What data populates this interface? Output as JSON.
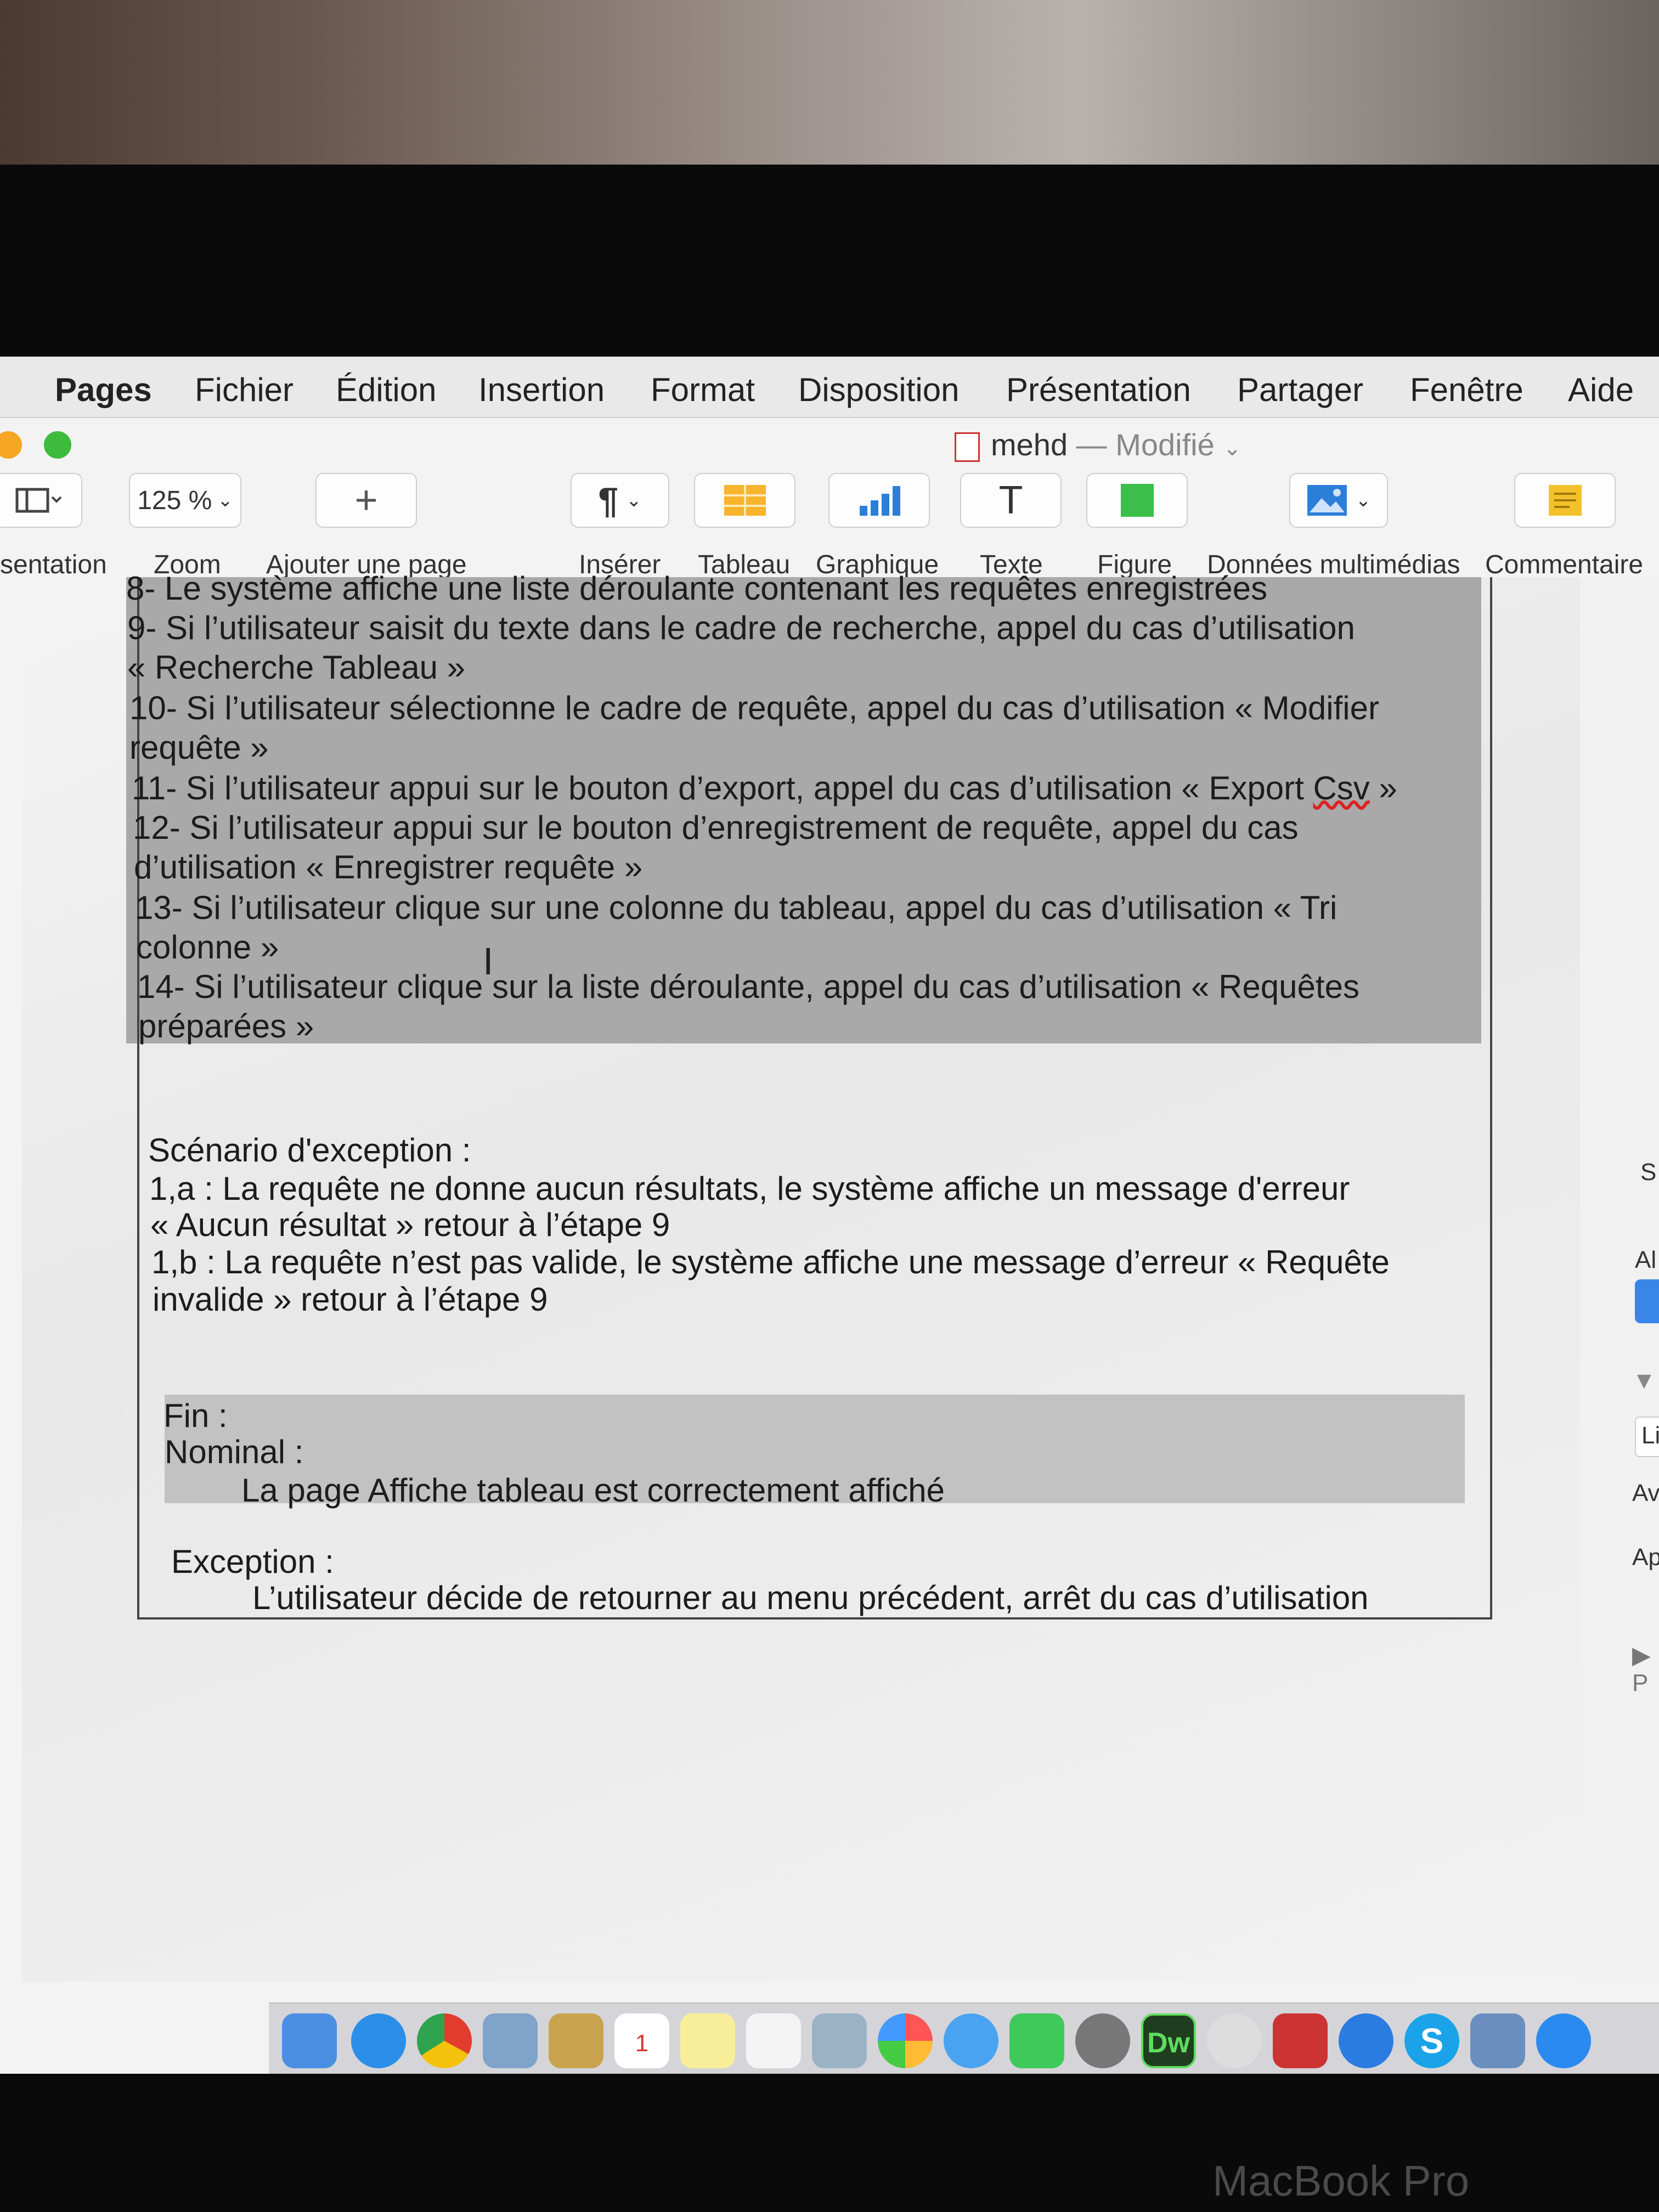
{
  "menubar": {
    "app_name": "Pages",
    "items": [
      "Fichier",
      "Édition",
      "Insertion",
      "Format",
      "Disposition",
      "Présentation",
      "Partager",
      "Fenêtre",
      "Aide"
    ]
  },
  "window": {
    "doc_name": "mehd",
    "separator": "—",
    "status": "Modifié",
    "status_chevron": "⌄"
  },
  "toolbar": {
    "view_label": "sentation",
    "zoom_value": "125 %",
    "zoom_label": "Zoom",
    "add_page_symbol": "+",
    "add_page_label": "Ajouter une page",
    "insert_symbol": "¶",
    "insert_label": "Insérer",
    "table_label": "Tableau",
    "chart_label": "Graphique",
    "text_symbol": "T",
    "text_label": "Texte",
    "shape_label": "Figure",
    "media_label": "Données multimédias",
    "comment_label": "Commentaire",
    "icons": [
      "sidebar-view-icon",
      "insert-paragraph-icon",
      "table-icon",
      "chart-icon",
      "text-icon",
      "shape-icon",
      "media-icon",
      "comment-icon"
    ]
  },
  "document": {
    "step8": "8- Le système affiche une liste déroulante contenant les requêtes enregistrées",
    "step9_a": "9- Si l’utilisateur saisit du texte dans le cadre de recherche, appel du cas d’utilisation",
    "step9_b": "« Recherche Tableau »",
    "step10_a": "10- Si l’utilisateur sélectionne le cadre de requête, appel du cas d’utilisation « Modifier",
    "step10_b": "requête »",
    "step11_a": "11- Si l’utilisateur appui sur le bouton d’export, appel du cas d’utilisation « Export ",
    "step11_word": "Csv",
    "step11_c": " »",
    "step12_a": "12- Si l’utilisateur appui sur le bouton d’enregistrement de requête, appel du cas",
    "step12_b": "d’utilisation « Enregistrer requête »",
    "step13_a": "13- Si l’utilisateur clique sur une colonne du tableau, appel du cas d’utilisation « Tri",
    "step13_b": "colonne »",
    "step14_a": "14- Si l’utilisateur clique sur la liste déroulante, appel du cas d’utilisation « Requêtes",
    "step14_b": "préparées »",
    "exception_title": "Scénario d'exception :",
    "exc_1a_a": "1,a : La requête ne donne aucun résultats, le système affiche un message d'erreur",
    "exc_1a_b": "« Aucun résultat » retour à l’étape 9",
    "exc_1b_a": "1,b : La requête n’est pas valide, le système affiche une message d’erreur « Requête",
    "exc_1b_b": "invalide » retour à l’étape 9",
    "fin_label": "Fin :",
    "nominal_label": "Nominal :",
    "nominal_text": "La page Affiche tableau est correctement affiché",
    "exception_label": "Exception :",
    "exception_text": "L’utilisateur décide de retourner au menu précédent, arrêt du cas d’utilisation",
    "cursor": "I"
  },
  "inspector": {
    "t1": "S",
    "t2": "Al",
    "t3": "Li",
    "t4": "Ava",
    "t5": "Apr",
    "t6": "▶ P",
    "t7": "▼"
  },
  "dock": {
    "icons": [
      "finder-icon",
      "safari-icon",
      "chrome-icon",
      "preview-icon",
      "notes-folder-icon",
      "calendar-icon",
      "stickies-icon",
      "reminders-icon",
      "image-capture-icon",
      "photos-icon",
      "messages-icon",
      "facetime-icon",
      "system-preferences-icon",
      "dreamweaver-icon",
      "sequel-icon",
      "photo-booth-icon",
      "teamviewer-icon",
      "skype-icon",
      "virtualbox-icon",
      "app-store-icon"
    ],
    "dw_label": "Dw",
    "calendar_day": "1",
    "skype_letter": "S"
  },
  "brand": "MacBook Pro",
  "colors": {
    "highlight_steps": "#a9a9a9",
    "highlight_fin": "#c2c2c2",
    "traffic_yellow": "#f5a623",
    "traffic_green": "#3dbb3d",
    "spell_underline": "#d22222"
  }
}
